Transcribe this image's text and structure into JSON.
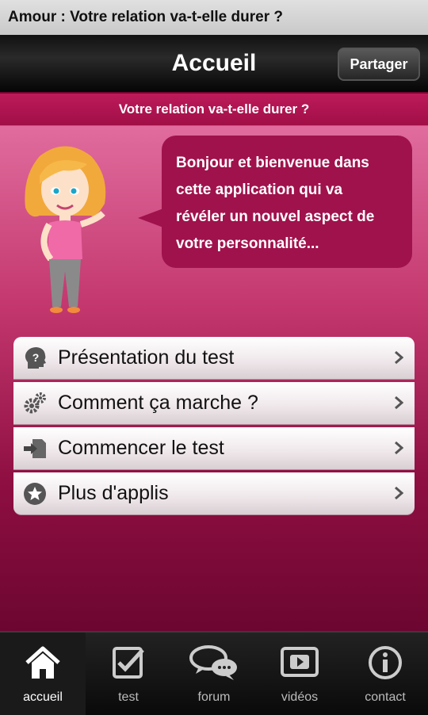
{
  "app_title": "Amour : Votre relation va-t-elle durer ?",
  "header": {
    "title": "Accueil",
    "share_label": "Partager"
  },
  "subtitle": "Votre relation va-t-elle durer ?",
  "welcome": {
    "lines": [
      "Bonjour et bienvenue dans",
      "cette application qui va",
      "révéler un nouvel aspect de",
      "votre personnalité..."
    ]
  },
  "menu": [
    {
      "label": "Présentation du test",
      "icon": "head-question-icon"
    },
    {
      "label": "Comment ça marche ?",
      "icon": "gears-icon"
    },
    {
      "label": "Commencer le test",
      "icon": "enter-document-icon"
    },
    {
      "label": "Plus d'applis",
      "icon": "star-circle-icon"
    }
  ],
  "tabs": [
    {
      "label": "accueil",
      "icon": "home-icon",
      "active": true
    },
    {
      "label": "test",
      "icon": "checklist-icon",
      "active": false
    },
    {
      "label": "forum",
      "icon": "chat-bubbles-icon",
      "active": false
    },
    {
      "label": "vidéos",
      "icon": "video-play-icon",
      "active": false
    },
    {
      "label": "contact",
      "icon": "info-icon",
      "active": false
    }
  ],
  "colors": {
    "accent": "#a0124c",
    "bar": "#bd1a5a"
  }
}
